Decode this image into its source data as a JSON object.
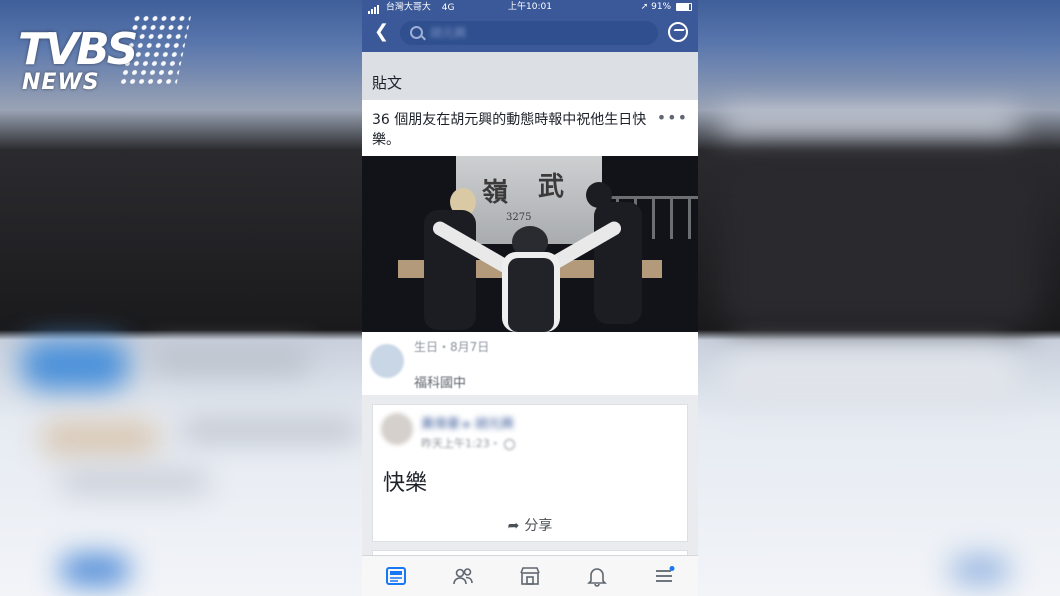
{
  "logo": {
    "top": "TVBS",
    "bottom": "NEWS"
  },
  "status": {
    "carrier": "台灣大哥大",
    "network": "4G",
    "time": "上午10:01",
    "battery": "91%"
  },
  "search": {
    "value": "胡元興"
  },
  "section": {
    "title": "貼文"
  },
  "card": {
    "text": "36 個朋友在胡元興的動態時報中祝他生日快樂。",
    "more": "•••",
    "photo": {
      "sign_chars": [
        "嶺",
        "武"
      ],
      "sign_sub": "3275"
    },
    "profile": {
      "birthday": "生日・8月7日",
      "school": "福科國中"
    }
  },
  "post": {
    "author": "黃偉豪 ▸ 胡元興",
    "timestamp": "昨天上午1:23・",
    "message": "快樂",
    "share_label": "分享"
  },
  "tabs": [
    {
      "name": "news-feed-icon",
      "active": true
    },
    {
      "name": "friends-icon",
      "active": false
    },
    {
      "name": "marketplace-icon",
      "active": false
    },
    {
      "name": "notifications-icon",
      "active": false
    },
    {
      "name": "menu-icon",
      "active": false
    }
  ],
  "colors": {
    "brand": "#3b5998",
    "active_tab": "#1877f2",
    "inactive_tab": "#606770"
  }
}
